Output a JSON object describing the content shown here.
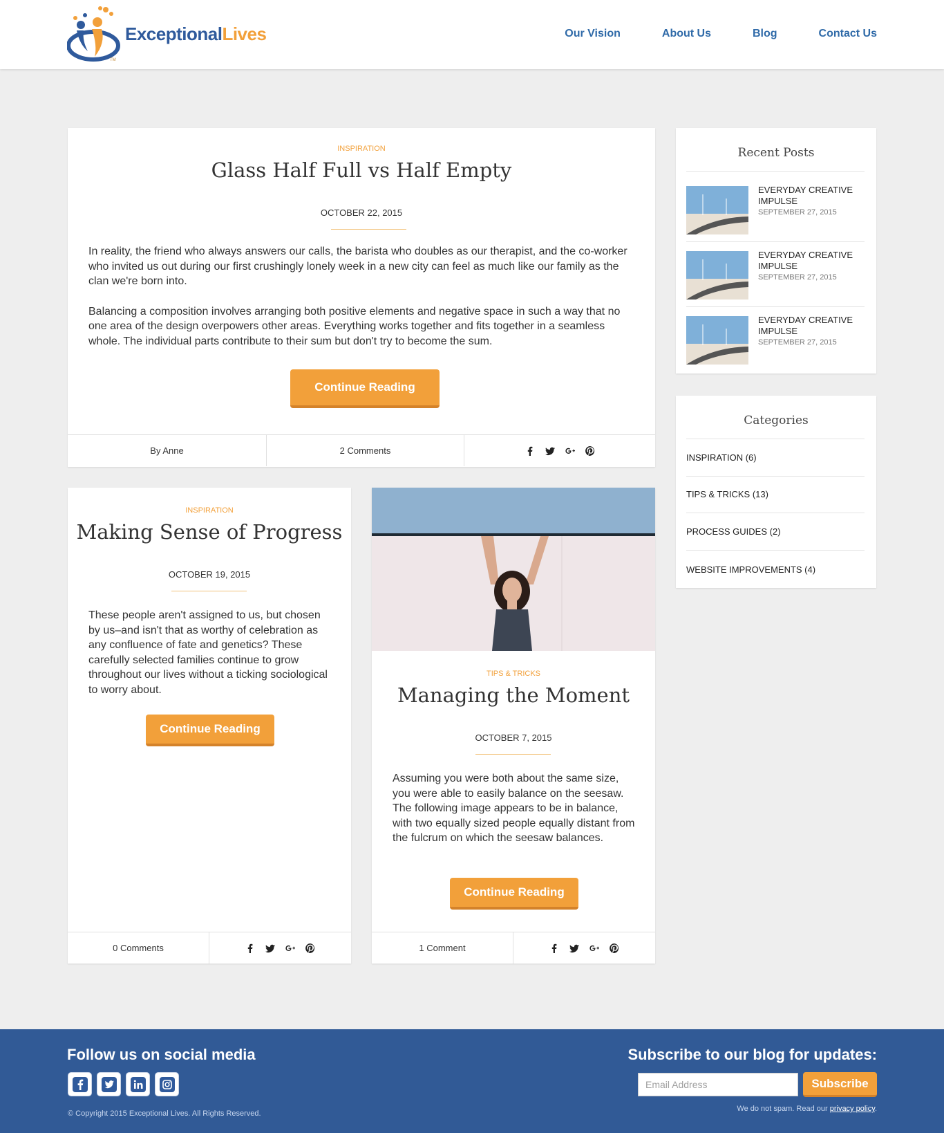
{
  "header": {
    "logo_text_a": "Exceptional",
    "logo_text_b": "Lives",
    "logo_tm": "TM",
    "nav": [
      "Our Vision",
      "About Us",
      "Blog",
      "Contact Us"
    ]
  },
  "posts": [
    {
      "category": "INSPIRATION",
      "title": "Glass Half Full vs Half Empty",
      "date": "OCTOBER 22, 2015",
      "paragraphs": [
        "In reality, the friend who always answers our calls, the barista who doubles as our therapist, and the co-worker who invited us out during our first crushingly lonely week in a new city can feel as much like our family as the clan we're born into.",
        "Balancing a composition involves arranging both positive elements and negative space in such a way that no one area of the design overpowers other areas. Everything works together and fits together in a seamless whole. The individual parts contribute to their sum but don't try to become the sum."
      ],
      "button": "Continue Reading",
      "author": "By Anne",
      "comments": "2 Comments"
    },
    {
      "category": "INSPIRATION",
      "title": "Making Sense of Progress",
      "date": "OCTOBER 19, 2015",
      "paragraphs": [
        "These people aren't assigned to us, but chosen by us–and isn't that as worthy of celebration as any confluence of fate and genetics? These carefully selected families continue to grow throughout our lives without a ticking sociological to worry about."
      ],
      "button": "Continue Reading",
      "comments": "0 Comments"
    },
    {
      "category": "TIPS & TRICKS",
      "title": "Managing the Moment",
      "date": "OCTOBER 7, 2015",
      "paragraphs": [
        "Assuming you were both about the same size, you were able to easily balance on the seesaw. The following image appears to be in balance, with two equally sized people equally distant from the fulcrum on which the seesaw balances."
      ],
      "button": "Continue Reading",
      "comments": "1 Comment"
    }
  ],
  "sidebar": {
    "recent_title": "Recent Posts",
    "recent": [
      {
        "title": "EVERYDAY CREATIVE IMPULSE",
        "date": "SEPTEMBER 27, 2015"
      },
      {
        "title": "EVERYDAY CREATIVE IMPULSE",
        "date": "SEPTEMBER 27, 2015"
      },
      {
        "title": "EVERYDAY CREATIVE IMPULSE",
        "date": "SEPTEMBER 27, 2015"
      }
    ],
    "categories_title": "Categories",
    "categories": [
      "INSPIRATION (6)",
      "TIPS & TRICKS (13)",
      "PROCESS GUIDES (2)",
      "WEBSITE IMPROVEMENTS (4)"
    ]
  },
  "footer": {
    "social_heading": "Follow us on social media",
    "copyright": "© Copyright 2015 Exceptional Lives. All Rights Reserved.",
    "subscribe_heading": "Subscribe to our blog for updates:",
    "email_placeholder": "Email Address",
    "subscribe_button": "Subscribe",
    "nospam_text": "We do not spam. Read our ",
    "privacy_link": "privacy policy",
    "nospam_end": "."
  },
  "colors": {
    "accent": "#f2a03a",
    "brand": "#2f5a9c",
    "footer": "#315a96"
  },
  "icons": [
    "facebook-icon",
    "twitter-icon",
    "google-plus-icon",
    "pinterest-icon",
    "linkedin-icon",
    "instagram-icon"
  ]
}
